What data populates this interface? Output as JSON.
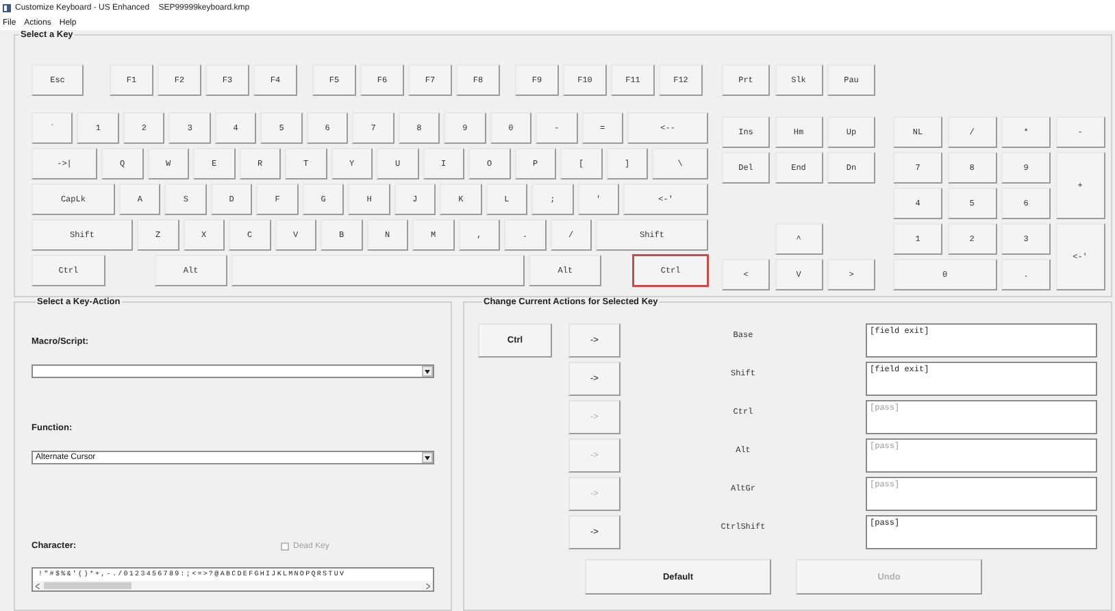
{
  "window": {
    "title": "Customize Keyboard - US Enhanced    SEP99999keyboard.kmp"
  },
  "menu": [
    "File",
    "Actions",
    "Help"
  ],
  "select_key": {
    "title": "Select a Key",
    "function_row": [
      {
        "label": "Esc",
        "selected": false
      },
      {
        "label": "F1",
        "selected": false
      },
      {
        "label": "F2",
        "selected": false
      },
      {
        "label": "F3",
        "selected": false
      },
      {
        "label": "F4",
        "selected": false
      },
      {
        "label": "F5",
        "selected": false
      },
      {
        "label": "F6",
        "selected": false
      },
      {
        "label": "F7",
        "selected": false
      },
      {
        "label": "F8",
        "selected": false
      },
      {
        "label": "F9",
        "selected": false
      },
      {
        "label": "F10",
        "selected": false
      },
      {
        "label": "F11",
        "selected": false
      },
      {
        "label": "F12",
        "selected": false
      }
    ],
    "main_rows": [
      [
        {
          "label": "`",
          "selected": false
        },
        {
          "label": "1",
          "selected": false
        },
        {
          "label": "2",
          "selected": false
        },
        {
          "label": "3",
          "selected": false
        },
        {
          "label": "4",
          "selected": false
        },
        {
          "label": "5",
          "selected": false
        },
        {
          "label": "6",
          "selected": false
        },
        {
          "label": "7",
          "selected": false
        },
        {
          "label": "8",
          "selected": false
        },
        {
          "label": "9",
          "selected": false
        },
        {
          "label": "0",
          "selected": false
        },
        {
          "label": "-",
          "selected": false
        },
        {
          "label": "=",
          "selected": false
        },
        {
          "label": "<--",
          "selected": false
        }
      ],
      [
        {
          "label": "->|",
          "selected": false
        },
        {
          "label": "Q",
          "selected": false
        },
        {
          "label": "W",
          "selected": false
        },
        {
          "label": "E",
          "selected": false
        },
        {
          "label": "R",
          "selected": false
        },
        {
          "label": "T",
          "selected": false
        },
        {
          "label": "Y",
          "selected": false
        },
        {
          "label": "U",
          "selected": false
        },
        {
          "label": "I",
          "selected": false
        },
        {
          "label": "O",
          "selected": false
        },
        {
          "label": "P",
          "selected": false
        },
        {
          "label": "[",
          "selected": false
        },
        {
          "label": "]",
          "selected": false
        },
        {
          "label": "\\",
          "selected": false
        }
      ],
      [
        {
          "label": "CapLk",
          "selected": false
        },
        {
          "label": "A",
          "selected": false
        },
        {
          "label": "S",
          "selected": false
        },
        {
          "label": "D",
          "selected": false
        },
        {
          "label": "F",
          "selected": false
        },
        {
          "label": "G",
          "selected": false
        },
        {
          "label": "H",
          "selected": false
        },
        {
          "label": "J",
          "selected": false
        },
        {
          "label": "K",
          "selected": false
        },
        {
          "label": "L",
          "selected": false
        },
        {
          "label": ";",
          "selected": false
        },
        {
          "label": "'",
          "selected": false
        },
        {
          "label": "<-'",
          "selected": false
        }
      ],
      [
        {
          "label": "Shift",
          "selected": false
        },
        {
          "label": "Z",
          "selected": false
        },
        {
          "label": "X",
          "selected": false
        },
        {
          "label": "C",
          "selected": false
        },
        {
          "label": "V",
          "selected": false
        },
        {
          "label": "B",
          "selected": false
        },
        {
          "label": "N",
          "selected": false
        },
        {
          "label": "M",
          "selected": false
        },
        {
          "label": ",",
          "selected": false
        },
        {
          "label": ".",
          "selected": false
        },
        {
          "label": "/",
          "selected": false
        },
        {
          "label": "Shift",
          "selected": false
        }
      ],
      [
        {
          "label": "Ctrl",
          "selected": false
        },
        {
          "label": "Alt",
          "selected": false
        },
        {
          "selected": false
        },
        {
          "label": "Alt",
          "selected": false
        },
        {
          "label": "Ctrl",
          "selected": true
        }
      ]
    ],
    "nav_keys": [
      {
        "label": "Prt",
        "selected": false
      },
      {
        "label": "Slk",
        "selected": false
      },
      {
        "label": "Pau",
        "selected": false
      },
      {
        "label": "Ins",
        "selected": false
      },
      {
        "label": "Hm",
        "selected": false
      },
      {
        "label": "Up",
        "selected": false
      },
      {
        "label": "Del",
        "selected": false
      },
      {
        "label": "End",
        "selected": false
      },
      {
        "label": "Dn",
        "selected": false
      },
      {
        "label": "^",
        "selected": false
      },
      {
        "label": "<",
        "selected": false
      },
      {
        "label": "V",
        "selected": false
      },
      {
        "label": ">",
        "selected": false
      }
    ],
    "numpad_keys": [
      {
        "label": "NL",
        "selected": false
      },
      {
        "label": "/",
        "selected": false
      },
      {
        "label": "*",
        "selected": false
      },
      {
        "label": "-",
        "selected": false
      },
      {
        "label": "7",
        "selected": false
      },
      {
        "label": "8",
        "selected": false
      },
      {
        "label": "9",
        "selected": false
      },
      {
        "label": "+",
        "selected": false
      },
      {
        "label": "4",
        "selected": false
      },
      {
        "label": "5",
        "selected": false
      },
      {
        "label": "6",
        "selected": false
      },
      {
        "label": "1",
        "selected": false
      },
      {
        "label": "2",
        "selected": false
      },
      {
        "label": "3",
        "selected": false
      },
      {
        "label": "<-'",
        "selected": false
      },
      {
        "label": "0",
        "selected": false
      },
      {
        "label": ".",
        "selected": false
      }
    ]
  },
  "key_action": {
    "title": "Select a Key-Action",
    "macro": {
      "label": "Macro/Script:"
    },
    "function": {
      "label": "Function:",
      "value": "Alternate Cursor"
    },
    "character": {
      "label": "Character:",
      "strip": "!\"#$%&'()*+,-./0123456789:;<=>?@ABCDEFGHIJKLMNOPQRSTUV"
    },
    "dead_key": {
      "label": "Dead Key",
      "checked": false,
      "disabled": true
    }
  },
  "current_actions": {
    "title": "Change Current Actions for Selected Key",
    "key": "Ctrl",
    "rows": [
      {
        "button": "->",
        "button_disabled": false,
        "label": "Base",
        "value": "[field exit]",
        "value_disabled": false
      },
      {
        "button": "->",
        "button_disabled": false,
        "label": "Shift",
        "value": "[field exit]",
        "value_disabled": false
      },
      {
        "button": "->",
        "button_disabled": true,
        "label": "Ctrl",
        "value": "[pass]",
        "value_disabled": true
      },
      {
        "button": "->",
        "button_disabled": true,
        "label": "Alt",
        "value": "[pass]",
        "value_disabled": true
      },
      {
        "button": "->",
        "button_disabled": true,
        "label": "AltGr",
        "value": "[pass]",
        "value_disabled": true
      },
      {
        "button": "->",
        "button_disabled": false,
        "label": "CtrlShift",
        "value": "[pass]",
        "value_disabled": false
      }
    ],
    "buttons": [
      {
        "label": "Default",
        "disabled": false
      },
      {
        "label": "Undo",
        "disabled": true
      }
    ]
  }
}
